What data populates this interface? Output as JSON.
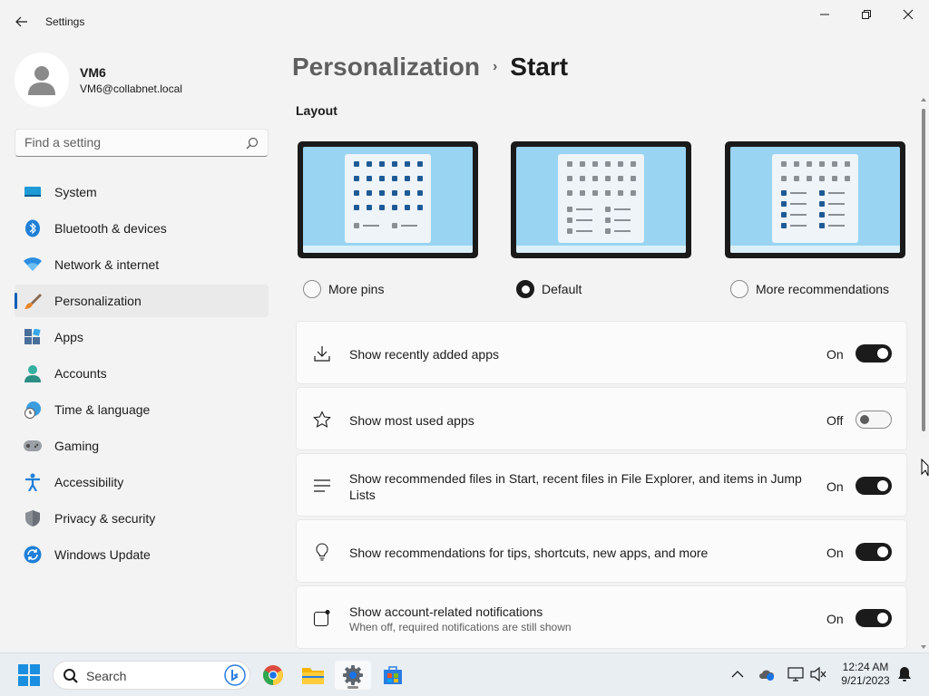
{
  "window": {
    "title": "Settings"
  },
  "user": {
    "name": "VM6",
    "email": "VM6@collabnet.local"
  },
  "search": {
    "placeholder": "Find a setting"
  },
  "sidebar": {
    "items": [
      {
        "label": "System"
      },
      {
        "label": "Bluetooth & devices"
      },
      {
        "label": "Network & internet"
      },
      {
        "label": "Personalization",
        "selected": true
      },
      {
        "label": "Apps"
      },
      {
        "label": "Accounts"
      },
      {
        "label": "Time & language"
      },
      {
        "label": "Gaming"
      },
      {
        "label": "Accessibility"
      },
      {
        "label": "Privacy & security"
      },
      {
        "label": "Windows Update"
      }
    ]
  },
  "breadcrumb": {
    "parent": "Personalization",
    "separator": "›",
    "current": "Start"
  },
  "layout": {
    "title": "Layout",
    "options": [
      {
        "label": "More pins",
        "checked": false
      },
      {
        "label": "Default",
        "checked": true
      },
      {
        "label": "More recommendations",
        "checked": false
      }
    ]
  },
  "settings": [
    {
      "title": "Show recently added apps",
      "state": "On",
      "on": true,
      "icon": "download-icon"
    },
    {
      "title": "Show most used apps",
      "state": "Off",
      "on": false,
      "icon": "star-icon"
    },
    {
      "title": "Show recommended files in Start, recent files in File Explorer, and items in Jump Lists",
      "state": "On",
      "on": true,
      "icon": "list-icon"
    },
    {
      "title": "Show recommendations for tips, shortcuts, new apps, and more",
      "state": "On",
      "on": true,
      "icon": "lightbulb-icon"
    },
    {
      "title": "Show account-related notifications",
      "desc": "When off, required notifications are still shown",
      "state": "On",
      "on": true,
      "icon": "notification-icon"
    }
  ],
  "taskbar": {
    "search_label": "Search",
    "time": "12:24 AM",
    "date": "9/21/2023"
  },
  "colors": {
    "accent": "#005fb8",
    "toggle_on": "#1b1b1b",
    "background": "#f3f3f3"
  }
}
